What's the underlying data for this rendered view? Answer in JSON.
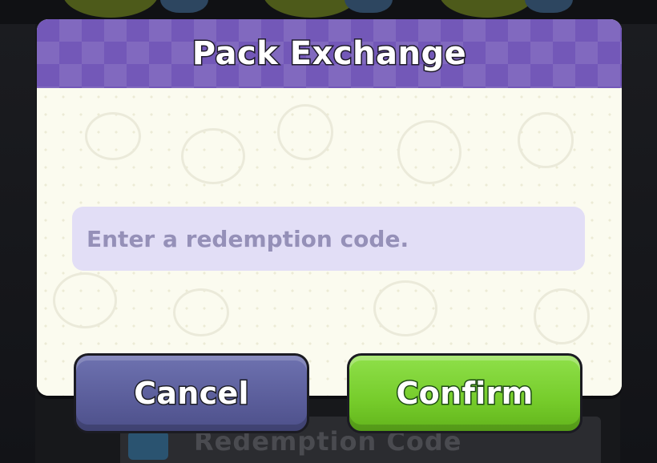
{
  "background": {
    "footer_label": "Redemption Code"
  },
  "dialog": {
    "title": "Pack Exchange",
    "input": {
      "placeholder": "Enter a redemption code.",
      "value": ""
    },
    "buttons": {
      "cancel_label": "Cancel",
      "confirm_label": "Confirm"
    }
  },
  "colors": {
    "header": "#7358b8",
    "body": "#fbfbef",
    "input": "#e2def6",
    "cancel": "#5a5d9a",
    "confirm": "#76cc2b"
  }
}
